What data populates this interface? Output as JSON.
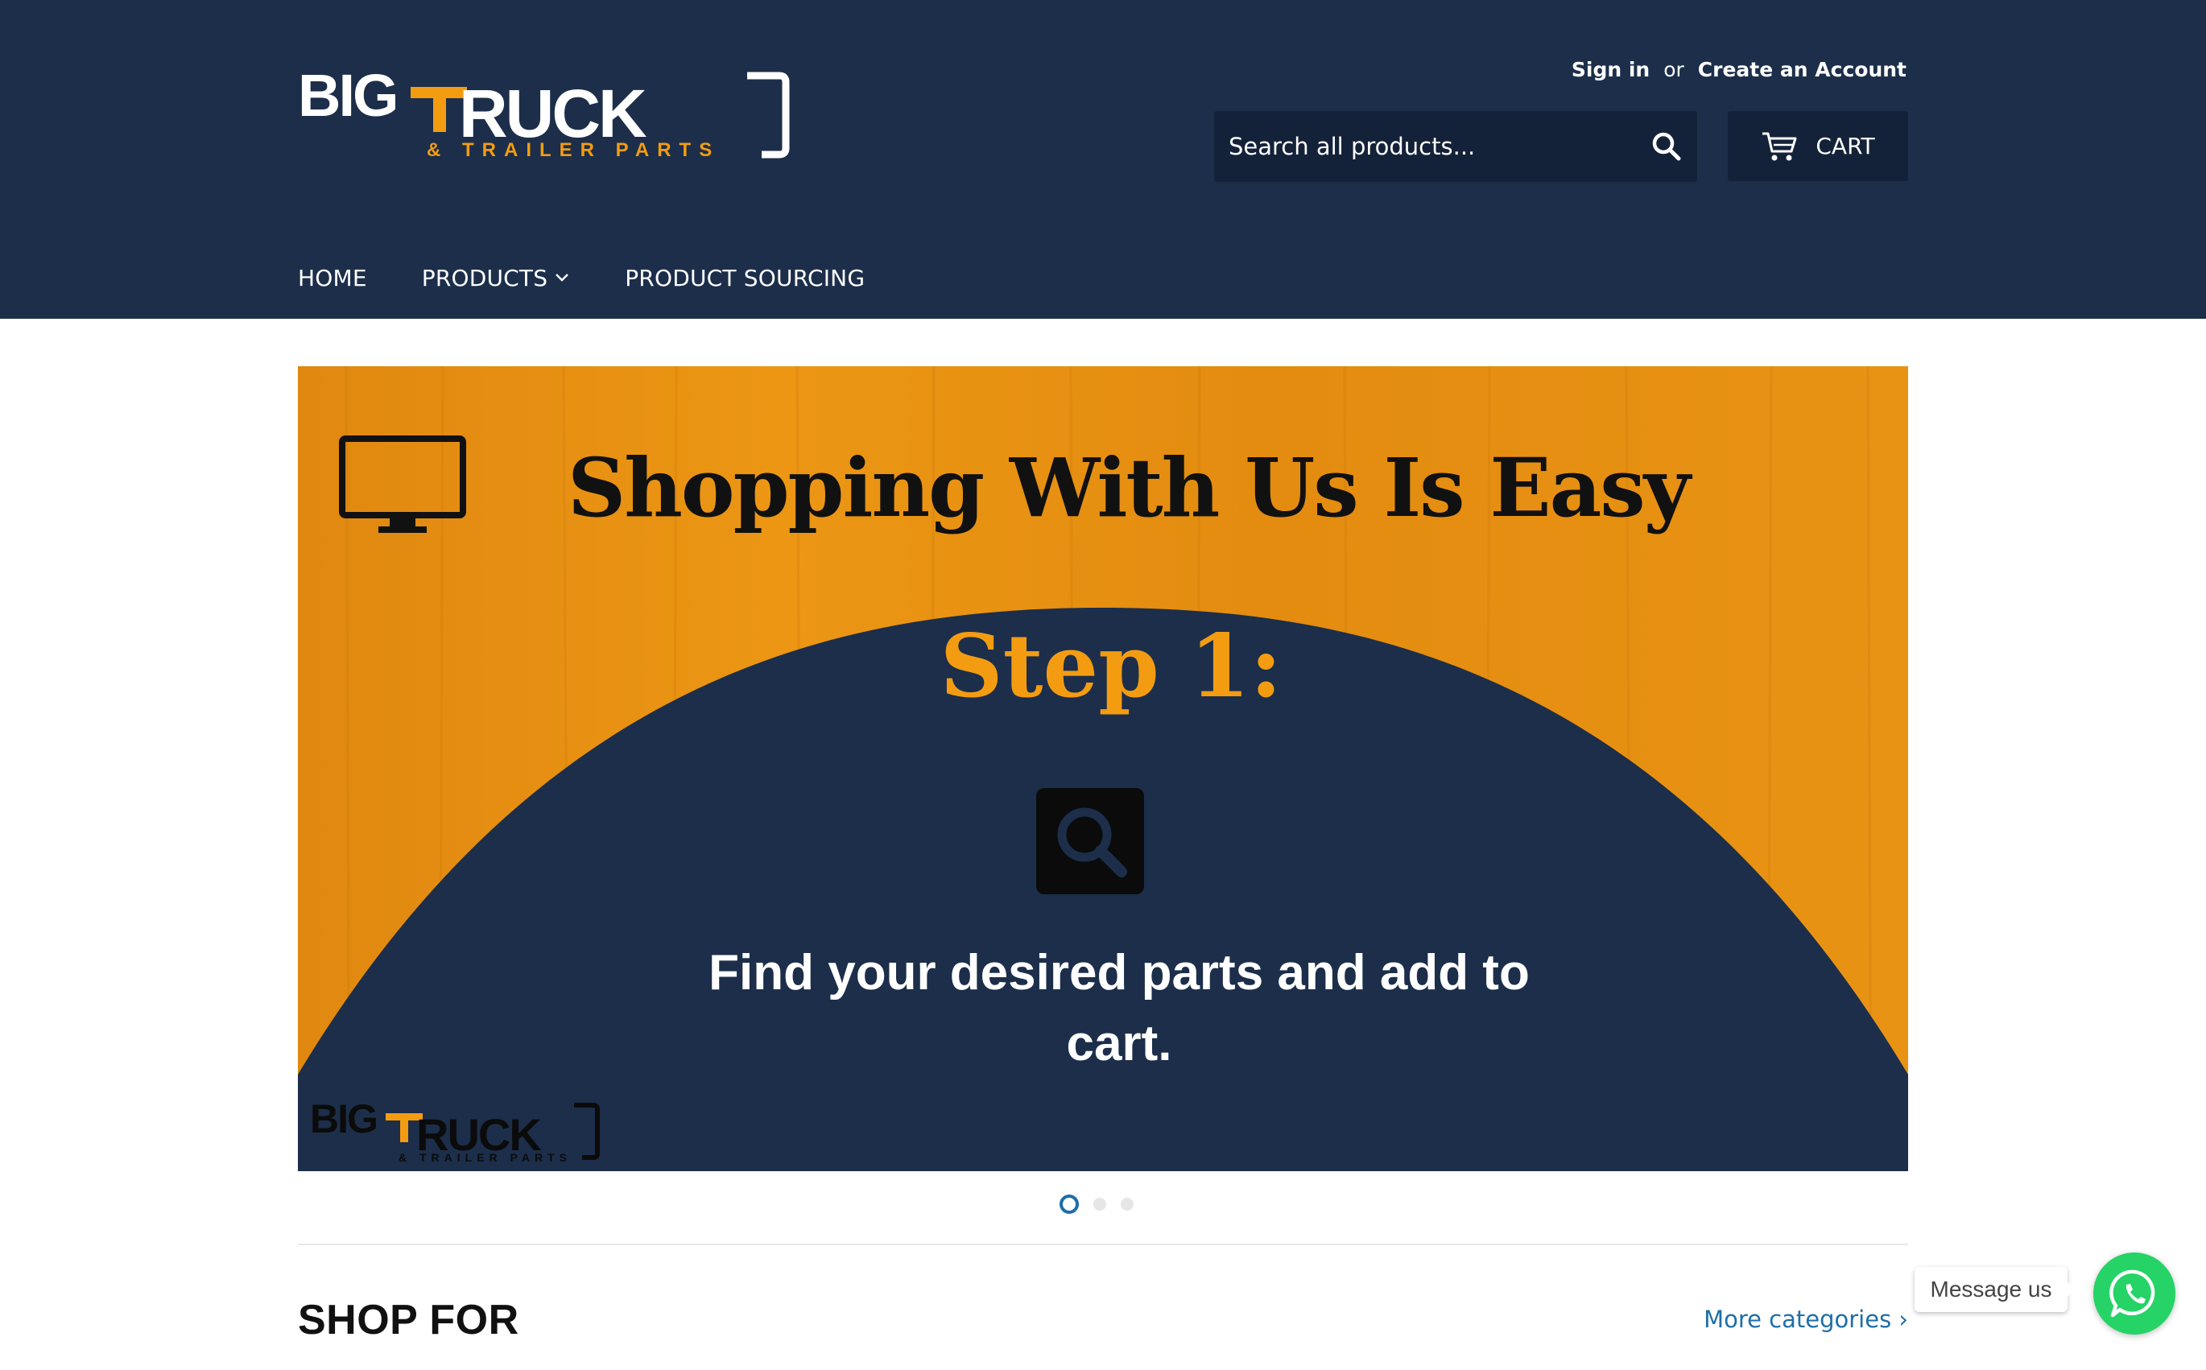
{
  "header": {
    "logo": {
      "alt": "BIG TRUCK & TRAILER PARTS",
      "word_big": "BIG",
      "word_truck": "TRUCK",
      "tagline": "& TRAILER PARTS"
    },
    "account": {
      "sign_in": "Sign in",
      "or": "or",
      "create_account": "Create an Account"
    },
    "search": {
      "placeholder": "Search all products...",
      "icon": "search-icon"
    },
    "cart": {
      "label": "CART",
      "icon": "cart-icon"
    },
    "nav": {
      "home": "HOME",
      "products": "PRODUCTS",
      "product_sourcing": "PRODUCT SOURCING"
    }
  },
  "hero": {
    "heading": "Shopping With Us Is Easy",
    "step": "Step 1:",
    "description": "Find your desired parts and add to cart.",
    "slides_total": 3,
    "active_slide": 1
  },
  "section": {
    "title": "SHOP FOR",
    "more_link": "More categories ›"
  },
  "chat": {
    "bubble": "Message us",
    "icon": "whatsapp-icon"
  },
  "colors": {
    "header_bg": "#1c2e4a",
    "accent_orange": "#f39c12",
    "link_blue": "#1d6fa8",
    "whatsapp_green": "#25d366"
  }
}
